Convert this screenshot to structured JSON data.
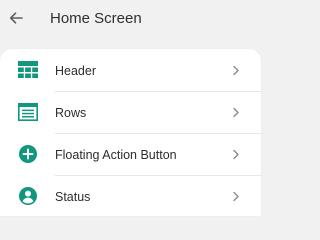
{
  "header": {
    "title": "Home Screen",
    "back_icon": "arrow-left-icon"
  },
  "colors": {
    "accent": "#12977f",
    "text": "#2d2d2d",
    "chevron": "#8a8a8a",
    "background": "#f1f1f1"
  },
  "list": {
    "items": [
      {
        "label": "Header",
        "icon": "table-grid-icon"
      },
      {
        "label": "Rows",
        "icon": "rows-list-icon"
      },
      {
        "label": "Floating Action Button",
        "icon": "add-circle-icon"
      },
      {
        "label": "Status",
        "icon": "account-circle-icon"
      }
    ]
  }
}
